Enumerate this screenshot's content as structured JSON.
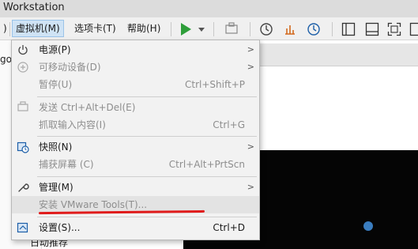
{
  "window": {
    "title": "Workstation"
  },
  "menubar": {
    "items": [
      {
        "label": ")"
      },
      {
        "label": "虚拟机(M)"
      },
      {
        "label": "选项卡(T)"
      },
      {
        "label": "帮助(H)"
      }
    ]
  },
  "toolbar": {
    "icons": [
      "play-icon",
      "dropdown-arrow-icon",
      "send-keys-icon",
      "snapshot-icon",
      "revert-snapshot-icon",
      "snapshot-manager-icon",
      "library-view-icon",
      "console-view-icon",
      "fullscreen-icon",
      "unity-icon"
    ],
    "play_color": "#2e9e3a"
  },
  "background": {
    "left_fragment": "go",
    "bottom_fragment": "日动推荐"
  },
  "vm_menu": {
    "items": [
      {
        "label": "电源(P)",
        "shortcut": "",
        "submenu": true,
        "disabled": false,
        "icon": "power-icon"
      },
      {
        "label": "可移动设备(D)",
        "shortcut": "",
        "submenu": true,
        "disabled": true,
        "icon": "removable-devices-icon"
      },
      {
        "label": "暂停(U)",
        "shortcut": "Ctrl+Shift+P",
        "submenu": false,
        "disabled": true,
        "icon": ""
      },
      {
        "label": "发送 Ctrl+Alt+Del(E)",
        "shortcut": "",
        "submenu": false,
        "disabled": true,
        "icon": "send-ctrl-alt-del-icon"
      },
      {
        "label": "抓取输入内容(I)",
        "shortcut": "Ctrl+G",
        "submenu": false,
        "disabled": true,
        "icon": ""
      },
      {
        "label": "快照(N)",
        "shortcut": "",
        "submenu": true,
        "disabled": false,
        "icon": "snapshot-icon"
      },
      {
        "label": "捕获屏幕 (C)",
        "shortcut": "Ctrl+Alt+PrtScn",
        "submenu": false,
        "disabled": true,
        "icon": ""
      },
      {
        "label": "管理(M)",
        "shortcut": "",
        "submenu": true,
        "disabled": false,
        "icon": "wrench-icon"
      },
      {
        "label": "安装 VMware Tools(T)...",
        "shortcut": "",
        "submenu": false,
        "disabled": true,
        "icon": ""
      },
      {
        "label": "设置(S)...",
        "shortcut": "Ctrl+D",
        "submenu": false,
        "disabled": false,
        "icon": "settings-icon"
      }
    ],
    "highlight_color": "#e01b1b"
  }
}
